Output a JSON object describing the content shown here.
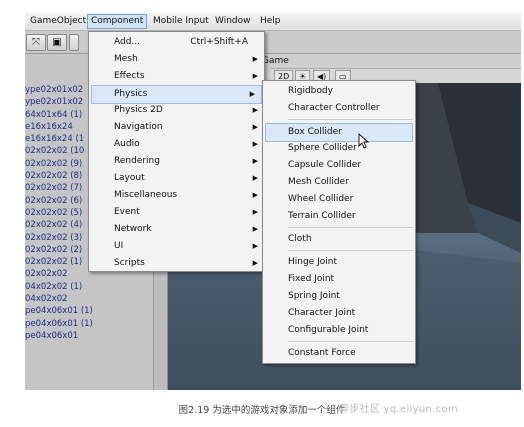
{
  "menubar": {
    "items": [
      {
        "label": "GameObject"
      },
      {
        "label": "Component"
      },
      {
        "label": "Mobile Input"
      },
      {
        "label": "Window"
      },
      {
        "label": "Help"
      }
    ]
  },
  "hierarchy": {
    "rows": [
      "ype02x01x02",
      "ype02x01x02",
      "64x01x64 (1)",
      "e16x16x24",
      "e16x16x24 (1",
      "02x02x02 (10",
      "02x02x02 (9)",
      "02x02x02 (8)",
      "02x02x02 (7)",
      "02x02x02 (6)",
      "02x02x02 (5)",
      "02x02x02 (4)",
      "02x02x02 (3)",
      "02x02x02 (2)",
      "02x02x02 (1)",
      "02x02x02",
      "04x02x02 (1)",
      "04x02x02",
      "pe04x06x01 (1)",
      "pe04x06x01 (1)",
      "pe04x06x01"
    ]
  },
  "scene": {
    "tab_label": "Game",
    "toolbar": [
      "2D",
      "☀",
      "◀)",
      "▭"
    ]
  },
  "component_menu": {
    "items": [
      {
        "label": "Add...",
        "shortcut": "Ctrl+Shift+A",
        "submenu": false
      },
      {
        "label": "Mesh",
        "submenu": true
      },
      {
        "label": "Effects",
        "submenu": true
      },
      {
        "label": "Physics",
        "submenu": true
      },
      {
        "label": "Physics 2D",
        "submenu": true
      },
      {
        "label": "Navigation",
        "submenu": true
      },
      {
        "label": "Audio",
        "submenu": true
      },
      {
        "label": "Rendering",
        "submenu": true
      },
      {
        "label": "Layout",
        "submenu": true
      },
      {
        "label": "Miscellaneous",
        "submenu": true
      },
      {
        "label": "Event",
        "submenu": true
      },
      {
        "label": "Network",
        "submenu": true
      },
      {
        "label": "UI",
        "submenu": true
      },
      {
        "label": "Scripts",
        "submenu": true
      }
    ]
  },
  "physics_submenu": {
    "groups": [
      [
        "Rigidbody",
        "Character Controller"
      ],
      [
        "Box Collider",
        "Sphere Collider",
        "Capsule Collider",
        "Mesh Collider",
        "Wheel Collider",
        "Terrain Collider"
      ],
      [
        "Cloth"
      ],
      [
        "Hinge Joint",
        "Fixed Joint",
        "Spring Joint",
        "Character Joint",
        "Configurable Joint"
      ],
      [
        "Constant Force"
      ]
    ]
  },
  "caption": "图2.19   为选中的游戏对象添加一个组件",
  "watermark": "异步社区 yq.eliyun.com",
  "colors": {
    "highlight": "#d9e7f6",
    "menubar_active": "#cfe3f7",
    "hierarchy_text": "#1a2f8a"
  }
}
